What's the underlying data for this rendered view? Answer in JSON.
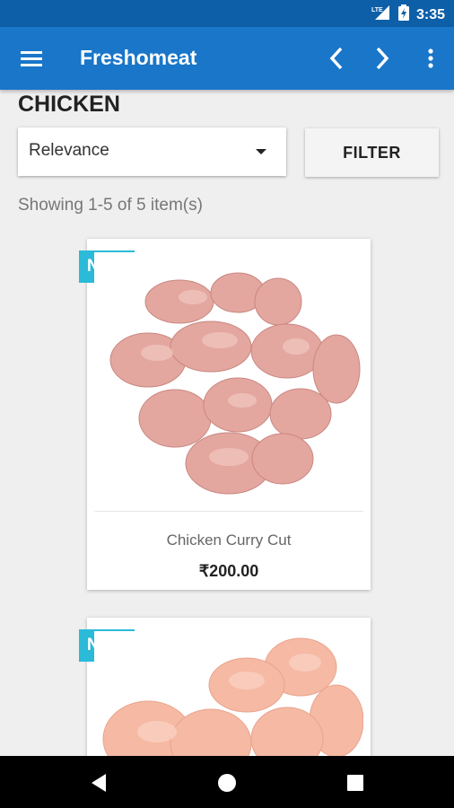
{
  "status_bar": {
    "network": "LTE",
    "time": "3:35"
  },
  "app_bar": {
    "menu_icon": "hamburger-menu-icon",
    "title": "Freshomeat",
    "back_icon": "chevron-left-icon",
    "forward_icon": "chevron-right-icon",
    "overflow_icon": "more-vert-icon"
  },
  "page": {
    "heading": "CHICKEN",
    "sort": {
      "selected": "Relevance"
    },
    "filter_label": "FILTER",
    "result_count": "Showing 1-5 of 5 item(s)"
  },
  "products": [
    {
      "badge": "NEW",
      "name": "Chicken Curry Cut",
      "price": "₹200.00"
    },
    {
      "badge": "NEW"
    }
  ],
  "colors": {
    "status_bar": "#0d5fa8",
    "app_bar": "#1976c9",
    "badge": "#2bbad8",
    "background": "#efefef"
  }
}
